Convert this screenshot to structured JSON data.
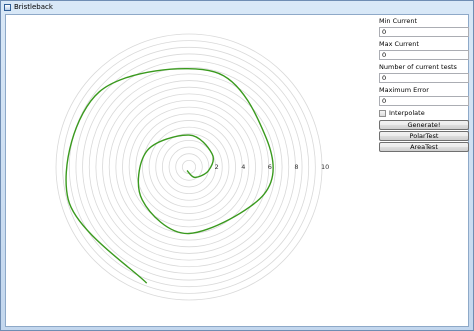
{
  "window": {
    "title": "Bristleback",
    "icon": "app-window-icon"
  },
  "chart_data": {
    "type": "polar",
    "radial_ticks": [
      "2",
      "4",
      "6",
      "8",
      "10"
    ],
    "radial_range": [
      0,
      10
    ],
    "grid_rings": [
      0.5,
      1,
      1.5,
      2,
      2.5,
      3,
      3.5,
      4,
      4.5,
      5,
      5.5,
      6,
      6.5,
      7,
      7.5,
      8,
      8.5,
      9,
      9.5,
      10
    ],
    "series": [
      {
        "color": "#3a9a1e",
        "points": [
          {
            "r": 0.3,
            "theta": 240
          },
          {
            "r": 0.9,
            "theta": 300
          },
          {
            "r": 1.5,
            "theta": 350
          },
          {
            "r": 2.0,
            "theta": 30
          },
          {
            "r": 2.4,
            "theta": 90
          },
          {
            "r": 3.4,
            "theta": 160
          },
          {
            "r": 4.3,
            "theta": 215
          },
          {
            "r": 5.0,
            "theta": 270
          },
          {
            "r": 6.0,
            "theta": 340
          },
          {
            "r": 6.2,
            "theta": 20
          },
          {
            "r": 7.4,
            "theta": 75
          },
          {
            "r": 8.8,
            "theta": 140
          },
          {
            "r": 9.4,
            "theta": 195
          },
          {
            "r": 9.3,
            "theta": 250
          }
        ]
      }
    ]
  },
  "controls": {
    "min_current": {
      "label": "Min Current",
      "value": "0"
    },
    "max_current": {
      "label": "Max Current",
      "value": "0"
    },
    "num_tests": {
      "label": "Number of current tests",
      "value": "0"
    },
    "max_error": {
      "label": "Maximum Error",
      "value": "0"
    },
    "interpolate": {
      "label": "Interpolate",
      "checked": false
    },
    "buttons": {
      "generate": "Generate!",
      "polar_test": "PolarTest",
      "area_test": "AreaTest"
    }
  }
}
